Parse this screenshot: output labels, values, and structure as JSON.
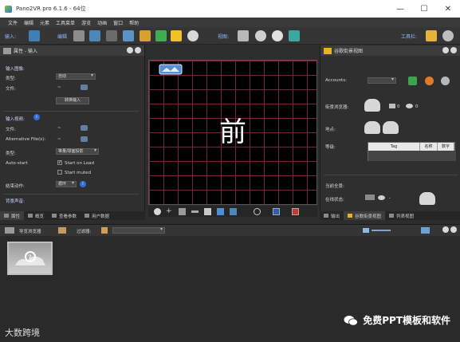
{
  "window": {
    "title": "Pano2VR pro 6.1.6 - 64位",
    "controls": [
      "—",
      "☐",
      "✕"
    ]
  },
  "menu": [
    "文件",
    "编辑",
    "元素",
    "工具菜单",
    "游览",
    "动画",
    "窗口",
    "帮助"
  ],
  "toolbar": {
    "input_label": "输入:",
    "edit_label": "编辑",
    "view_label": "视图:",
    "tools_label": "工具栏:"
  },
  "left_panel": {
    "title": "属性 - 输入",
    "input_image_section": "输入图像:",
    "type_label": "类型:",
    "type_value": "自动",
    "file_label": "文件:",
    "file_value": "~",
    "convert_button": "转换输入",
    "input_video_section": "输入视频:",
    "video_file_label": "文件:",
    "video_file_value": "~",
    "alt_file_label": "Alternative File(s):",
    "alt_file_value": "~",
    "video_type_label": "类型:",
    "video_type_value": "等量/球面投影",
    "autostart_label": "Auto-start",
    "start_on_load": "Start on Load",
    "start_muted": "Start muted",
    "end_action_label": "结束动作:",
    "end_action_value": "循环",
    "bg_sound_section": "背景声音:",
    "tabs": [
      "属性",
      "概览",
      "查看参数",
      "用户数据"
    ]
  },
  "viewport": {
    "center_label": "前"
  },
  "right_panel": {
    "title": "谷歌街景视图",
    "account_label": "Accounts:",
    "browser_label": "街景浏览器:",
    "browser_camera_count": "0",
    "browser_view_count": "0",
    "location_label": "地点:",
    "level_label": "等级:",
    "table_headers": [
      "Tag",
      "名称",
      "数字"
    ],
    "current_panorama_section": "当前全景:",
    "online_status_label": "在线状态:",
    "online_status_value": "-",
    "tabs": [
      "输出",
      "谷歌街景视图",
      "列表视图"
    ]
  },
  "tour_browser": {
    "title": "导览浏览器",
    "filter_label": "过滤器:"
  },
  "watermarks": {
    "left": "大数跨境",
    "right": "免费PPT模板和软件"
  }
}
